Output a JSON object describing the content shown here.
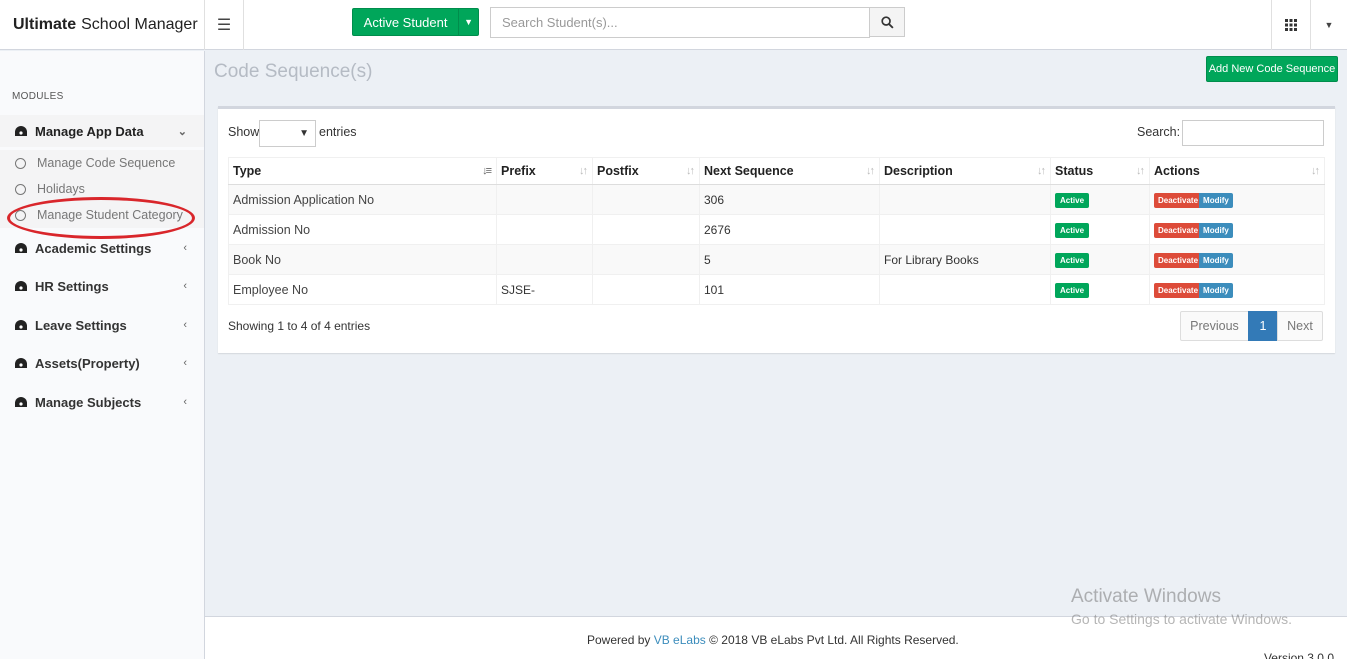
{
  "app": {
    "brand_bold": "Ultimate",
    "brand_rest": "School Manager"
  },
  "header": {
    "active_student_label": "Active Student",
    "search_placeholder": "Search Student(s)..."
  },
  "sidebar": {
    "heading": "MODULES",
    "open_menu": "Manage App Data",
    "sub_items": [
      "Manage Code Sequence",
      "Holidays",
      "Manage Student Category"
    ],
    "menus": [
      "Academic Settings",
      "HR Settings",
      "Leave Settings",
      "Assets(Property)",
      "Manage Subjects"
    ]
  },
  "page": {
    "title": "Code Sequence(s)",
    "add_button": "Add New Code Sequence"
  },
  "table": {
    "show_label": "Show",
    "entries_label": "entries",
    "search_label": "Search:",
    "columns": [
      "Type",
      "Prefix",
      "Postfix",
      "Next Sequence",
      "Description",
      "Status",
      "Actions"
    ],
    "rows": [
      {
        "type": "Admission Application No",
        "prefix": "",
        "postfix": "",
        "next": "306",
        "description": "",
        "status": "Active"
      },
      {
        "type": "Admission No",
        "prefix": "",
        "postfix": "",
        "next": "2676",
        "description": "",
        "status": "Active"
      },
      {
        "type": "Book No",
        "prefix": "",
        "postfix": "",
        "next": "5",
        "description": "For Library Books",
        "status": "Active"
      },
      {
        "type": "Employee No",
        "prefix": "SJSE-",
        "postfix": "",
        "next": "101",
        "description": "",
        "status": "Active"
      }
    ],
    "action_deactivate": "Deactivate",
    "action_modify": "Modify",
    "info": "Showing 1 to 4 of 4 entries",
    "pager": {
      "prev": "Previous",
      "current": "1",
      "next": "Next"
    }
  },
  "footer": {
    "powered_by": "Powered by",
    "link": "VB eLabs",
    "copyright": "© 2018 VB eLabs Pvt Ltd. All Rights Reserved.",
    "version": "Version 3.0.0"
  },
  "watermark": {
    "line1": "Activate Windows",
    "line2": "Go to Settings to activate Windows."
  }
}
